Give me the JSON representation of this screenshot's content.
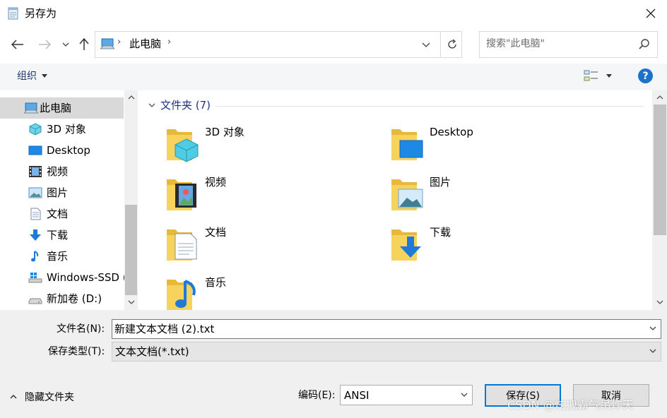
{
  "window": {
    "title": "另存为"
  },
  "nav": {
    "location": "此电脑"
  },
  "search": {
    "placeholder": "搜索\"此电脑\""
  },
  "toolbar": {
    "organize_label": "组织"
  },
  "help": {
    "label": "?"
  },
  "sidebar": {
    "items": [
      {
        "label": "此电脑",
        "icon": "computer-icon"
      },
      {
        "label": "3D 对象",
        "icon": "cube-3d-icon"
      },
      {
        "label": "Desktop",
        "icon": "desktop-icon"
      },
      {
        "label": "视频",
        "icon": "video-icon"
      },
      {
        "label": "图片",
        "icon": "picture-icon"
      },
      {
        "label": "文档",
        "icon": "document-icon"
      },
      {
        "label": "下载",
        "icon": "download-icon"
      },
      {
        "label": "音乐",
        "icon": "music-icon"
      },
      {
        "label": "Windows-SSD (",
        "icon": "drive-windows-icon"
      },
      {
        "label": "新加卷 (D:)",
        "icon": "drive-icon"
      }
    ]
  },
  "content": {
    "group_title": "文件夹 (7)",
    "folders": [
      {
        "label": "3D 对象"
      },
      {
        "label": "Desktop"
      },
      {
        "label": "视频"
      },
      {
        "label": "图片"
      },
      {
        "label": "文档"
      },
      {
        "label": "下载"
      },
      {
        "label": "音乐"
      }
    ]
  },
  "form": {
    "filename_label": "文件名(N):",
    "filename_value": "新建文本文档 (2).txt",
    "filetype_label": "保存类型(T):",
    "filetype_value": "文本文档(*.txt)",
    "hide_folders_label": "隐藏文件夹",
    "encoding_label": "编码(E):",
    "encoding_value": "ANSI",
    "save_label": "保存(S)",
    "cancel_label": "取消"
  },
  "watermark": "CSDN @炫拽霸气吊炸天",
  "colors": {
    "accent": "#0078d7",
    "folder": "#f7d35e",
    "selected": "#d9d9d9"
  }
}
